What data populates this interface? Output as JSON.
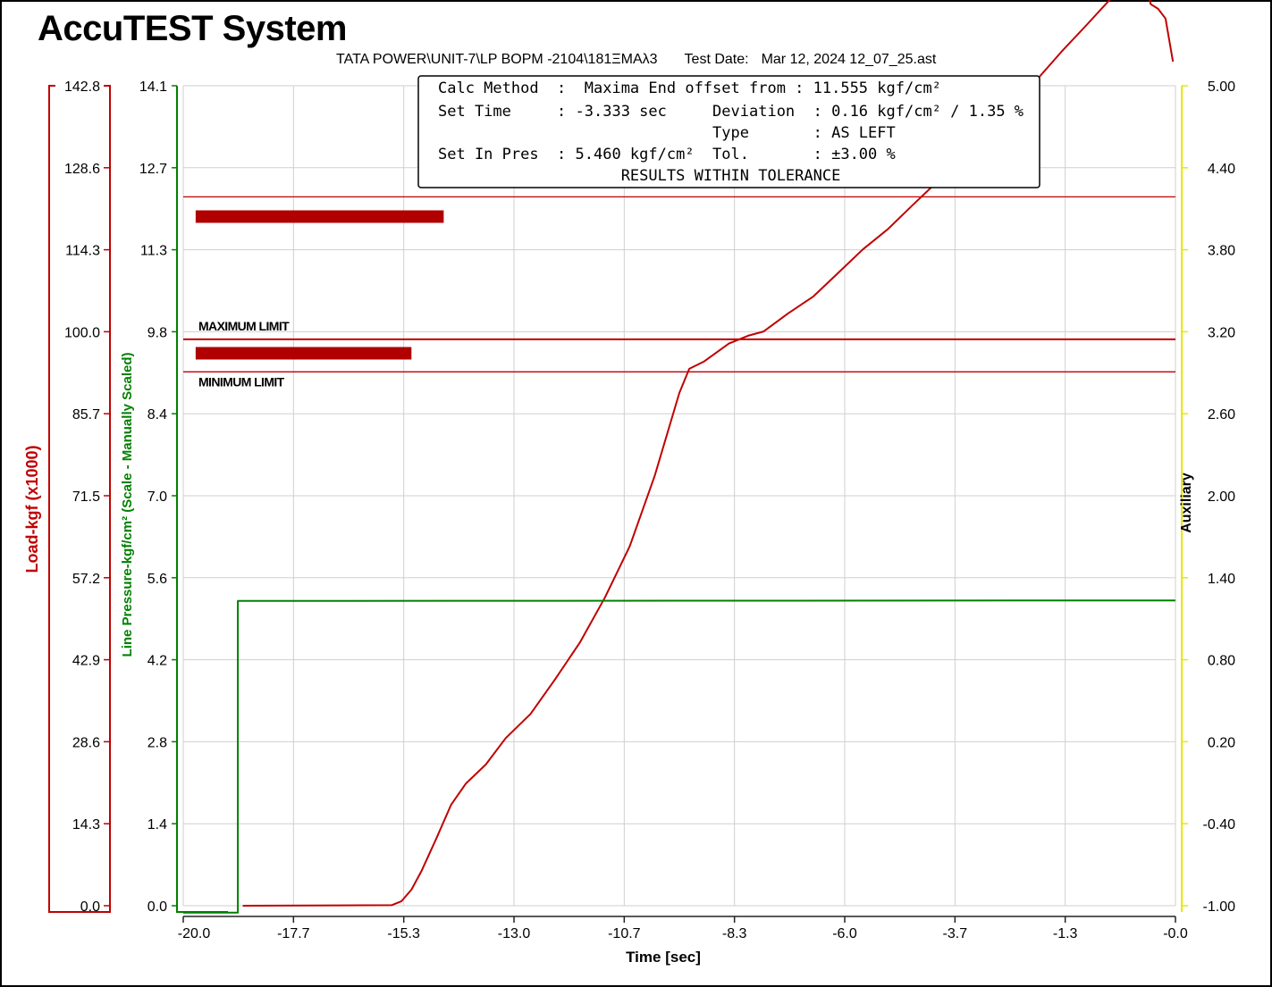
{
  "app": {
    "title": "AccuTEST System",
    "file_path": "TATA POWER\\UNIT-7\\LP BOPM -2104\\181ΞMAλ3",
    "test_date_label": "Test Date:",
    "test_date_value": "Mar 12, 2024 12_07_25.ast"
  },
  "results_box": {
    "rows": [
      "Calc Method  :  Maxima End offset from : 11.555 kgf/cm²",
      "Set Time     : -3.333 sec     Deviation  : 0.16 kgf/cm² / 1.35 %",
      "                              Type       : AS LEFT",
      "Set In Pres  : 5.460 kgf/cm²  Tol.       : ±3.00 %",
      "                    RESULTS WITHIN TOLERANCE"
    ]
  },
  "colors": {
    "load": "#c00000",
    "pressure": "#008000",
    "auxiliary": "#e8e800",
    "grid": "#cfcfcf",
    "limit": "#c00000",
    "bar": "#b00000"
  },
  "chart_data": {
    "type": "line",
    "title": "",
    "xlabel": "Time [sec]",
    "x_ticks": [
      "-20.0",
      "-17.7",
      "-15.3",
      "-13.0",
      "-10.7",
      "-8.3",
      "-6.0",
      "-3.7",
      "-1.3",
      "-0.0"
    ],
    "xlim": [
      -20.0,
      -0.0
    ],
    "grid": true,
    "axes": {
      "load": {
        "label": "Load-kgf (x1000)",
        "ticks": [
          "142.8",
          "128.6",
          "114.3",
          "100.0",
          "85.7",
          "71.5",
          "57.2",
          "42.9",
          "28.6",
          "14.3",
          "0.0"
        ],
        "ylim": [
          0.0,
          142.8
        ]
      },
      "pressure": {
        "label": "Line Pressure-kgf/cm² (Scale - Manually Scaled)",
        "ticks": [
          "14.1",
          "12.7",
          "11.3",
          "9.8",
          "8.4",
          "7.0",
          "5.6",
          "4.2",
          "2.8",
          "1.4",
          "0.0"
        ],
        "ylim": [
          0.0,
          14.1
        ]
      },
      "auxiliary": {
        "label": "Auxiliary",
        "ticks": [
          "5.00",
          "4.40",
          "3.80",
          "3.20",
          "2.60",
          "2.00",
          "1.40",
          "0.80",
          "0.20",
          "-0.40",
          "-1.00"
        ],
        "ylim": [
          -1.0,
          5.0
        ]
      }
    },
    "limits": {
      "maximum": {
        "label": "MAXIMUM LIMIT",
        "pressure": 9.74
      },
      "minimum": {
        "label": "MINIMUM LIMIT",
        "pressure": 9.18
      },
      "upper_reference": {
        "pressure": 12.19
      }
    },
    "bars": [
      {
        "x_start": -19.75,
        "x_end": -14.75,
        "pressure": 11.85
      },
      {
        "x_start": -19.75,
        "x_end": -15.4,
        "pressure": 9.5
      }
    ],
    "series": [
      {
        "name": "Load-kgf (x1000)",
        "axis": "load",
        "points": [
          [
            -18.8,
            0.0
          ],
          [
            -15.8,
            0.1
          ],
          [
            -15.6,
            0.8
          ],
          [
            -15.4,
            2.8
          ],
          [
            -15.2,
            6.0
          ],
          [
            -14.9,
            11.7
          ],
          [
            -14.6,
            17.6
          ],
          [
            -14.3,
            21.3
          ],
          [
            -13.9,
            24.6
          ],
          [
            -13.5,
            29.2
          ],
          [
            -13.0,
            33.4
          ],
          [
            -12.5,
            39.5
          ],
          [
            -12.0,
            45.9
          ],
          [
            -11.5,
            53.7
          ],
          [
            -11.0,
            62.6
          ],
          [
            -10.5,
            74.8
          ],
          [
            -10.0,
            89.3
          ],
          [
            -9.8,
            93.5
          ],
          [
            -9.5,
            94.8
          ],
          [
            -9.0,
            97.9
          ],
          [
            -8.6,
            99.3
          ],
          [
            -8.3,
            100.0
          ],
          [
            -7.8,
            103.2
          ],
          [
            -7.3,
            106.1
          ],
          [
            -6.8,
            110.2
          ],
          [
            -6.3,
            114.3
          ],
          [
            -5.8,
            117.8
          ],
          [
            -5.3,
            122.0
          ],
          [
            -4.8,
            126.1
          ],
          [
            -4.3,
            130.5
          ],
          [
            -3.8,
            134.9
          ],
          [
            -3.3,
            139.2
          ],
          [
            -2.8,
            143.8
          ],
          [
            -2.3,
            148.7
          ],
          [
            -1.8,
            153.3
          ],
          [
            -1.3,
            158.0
          ],
          [
            -0.9,
            161.3
          ],
          [
            -0.7,
            162.2
          ],
          [
            -0.6,
            160.7
          ],
          [
            -0.5,
            157.0
          ],
          [
            -0.35,
            156.2
          ],
          [
            -0.2,
            154.5
          ],
          [
            -0.05,
            147.0
          ]
        ]
      },
      {
        "name": "Line Pressure-kgf/cm²",
        "axis": "pressure",
        "points": [
          [
            -20.0,
            -0.12
          ],
          [
            -18.9,
            -0.12
          ],
          [
            -18.9,
            5.24
          ],
          [
            -0.0,
            5.25
          ]
        ]
      }
    ]
  }
}
